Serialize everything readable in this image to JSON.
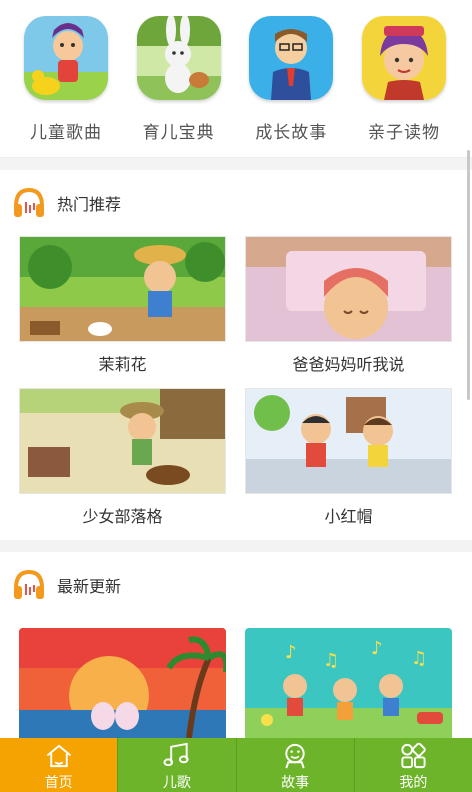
{
  "categories": [
    {
      "label": "儿童歌曲",
      "icon": "kid-singer-thumbnail"
    },
    {
      "label": "育儿宝典",
      "icon": "rabbit-thumbnail"
    },
    {
      "label": "成长故事",
      "icon": "teacher-thumbnail"
    },
    {
      "label": "亲子读物",
      "icon": "girl-reader-thumbnail"
    }
  ],
  "hot": {
    "title": "热门推荐",
    "icon": "headphones-icon",
    "items": [
      {
        "title": "茉莉花"
      },
      {
        "title": "爸爸妈妈听我说"
      },
      {
        "title": "少女部落格"
      },
      {
        "title": "小红帽"
      }
    ]
  },
  "newest": {
    "title": "最新更新",
    "icon": "headphones-icon"
  },
  "tabbar": {
    "tabs": [
      {
        "label": "首页",
        "icon": "home-icon",
        "active": true
      },
      {
        "label": "儿歌",
        "icon": "music-note-icon",
        "active": false
      },
      {
        "label": "故事",
        "icon": "smiley-icon",
        "active": false
      },
      {
        "label": "我的",
        "icon": "grid-icon",
        "active": false
      }
    ]
  },
  "colors": {
    "tab_bar": "#6db42a",
    "tab_active": "#f5a300",
    "headphone_orange": "#f39a1e"
  }
}
